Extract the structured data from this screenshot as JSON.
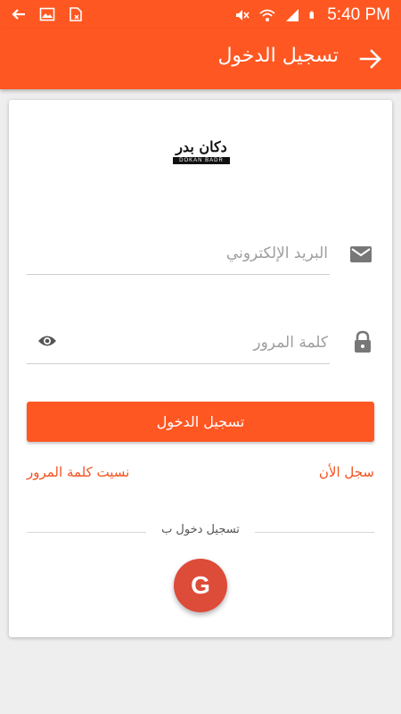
{
  "status_bar": {
    "time": "5:40 PM",
    "icons": [
      "back-arrow-icon",
      "image-icon",
      "document-icon",
      "mute-icon",
      "wifi-icon",
      "signal-icon",
      "battery-icon"
    ]
  },
  "app_bar": {
    "title": "تسجيل الدخول",
    "back_icon": "arrow-right-icon"
  },
  "logo": {
    "text": "دكان بدر",
    "subtext": "DOKAN BADR"
  },
  "form": {
    "email_placeholder": "البريد الإلكتروني",
    "email_icon": "mail-icon",
    "password_placeholder": "كلمة المرور",
    "password_icon": "lock-icon",
    "visibility_icon": "eye-icon",
    "login_button": "تسجيل الدخول",
    "register_link": "سجل الأن",
    "forgot_link": "نسيت كلمة المرور",
    "social_label": "تسجيل دخول ب",
    "google_label": "G"
  },
  "colors": {
    "primary": "#ff5722",
    "link": "#f4511e",
    "google": "#dd4b39",
    "background": "#eeeeee"
  }
}
